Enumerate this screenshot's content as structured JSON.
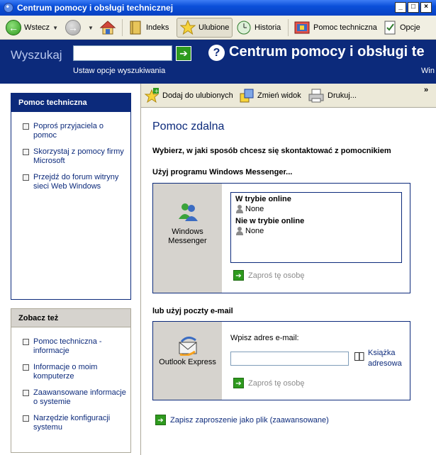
{
  "window": {
    "title": "Centrum pomocy i obsługi technicznej"
  },
  "toolbar": {
    "back": "Wstecz",
    "index": "Indeks",
    "favorites": "Ulubione",
    "history": "Historia",
    "support": "Pomoc techniczna",
    "options": "Opcje"
  },
  "banner": {
    "search_label": "Wyszukaj",
    "search_value": "",
    "search_options": "Ustaw opcje wyszukiwania",
    "center_title": "Centrum pomocy i obsługi te",
    "win_fragment": "Win"
  },
  "left": {
    "panel1_title": "Pomoc techniczna",
    "panel1_items": [
      "Poproś przyjaciela o pomoc",
      "Skorzystaj z pomocy firmy Microsoft",
      "Przejdź do forum witryny sieci Web Windows"
    ],
    "panel2_title": "Zobacz też",
    "panel2_items": [
      "Pomoc techniczna - informacje",
      "Informacje o moim komputerze",
      "Zaawansowane informacje o systemie",
      "Narzędzie konfiguracji systemu"
    ]
  },
  "content_toolbar": {
    "add_favorite": "Dodaj do ulubionych",
    "change_view": "Zmień widok",
    "print": "Drukuj...",
    "more": "»"
  },
  "content": {
    "title": "Pomoc zdalna",
    "lead": "Wybierz, w jaki sposób chcesz się skontaktować z pomocnikiem",
    "messenger_section": "Użyj programu Windows Messenger...",
    "messenger_caption": "Windows Messenger",
    "online_group": "W trybie online",
    "online_contact": "None",
    "offline_group": "Nie w trybie online",
    "offline_contact": "None",
    "invite_label": "Zaproś tę osobę",
    "email_section": "lub użyj poczty e-mail",
    "outlook_caption": "Outlook Express",
    "email_label": "Wpisz adres e-mail:",
    "email_value": "",
    "address_book": "Książka adresowa",
    "invite_label_email": "Zaproś tę osobę",
    "save_invitation": "Zapisz zaproszenie jako plik (zaawansowane)"
  }
}
